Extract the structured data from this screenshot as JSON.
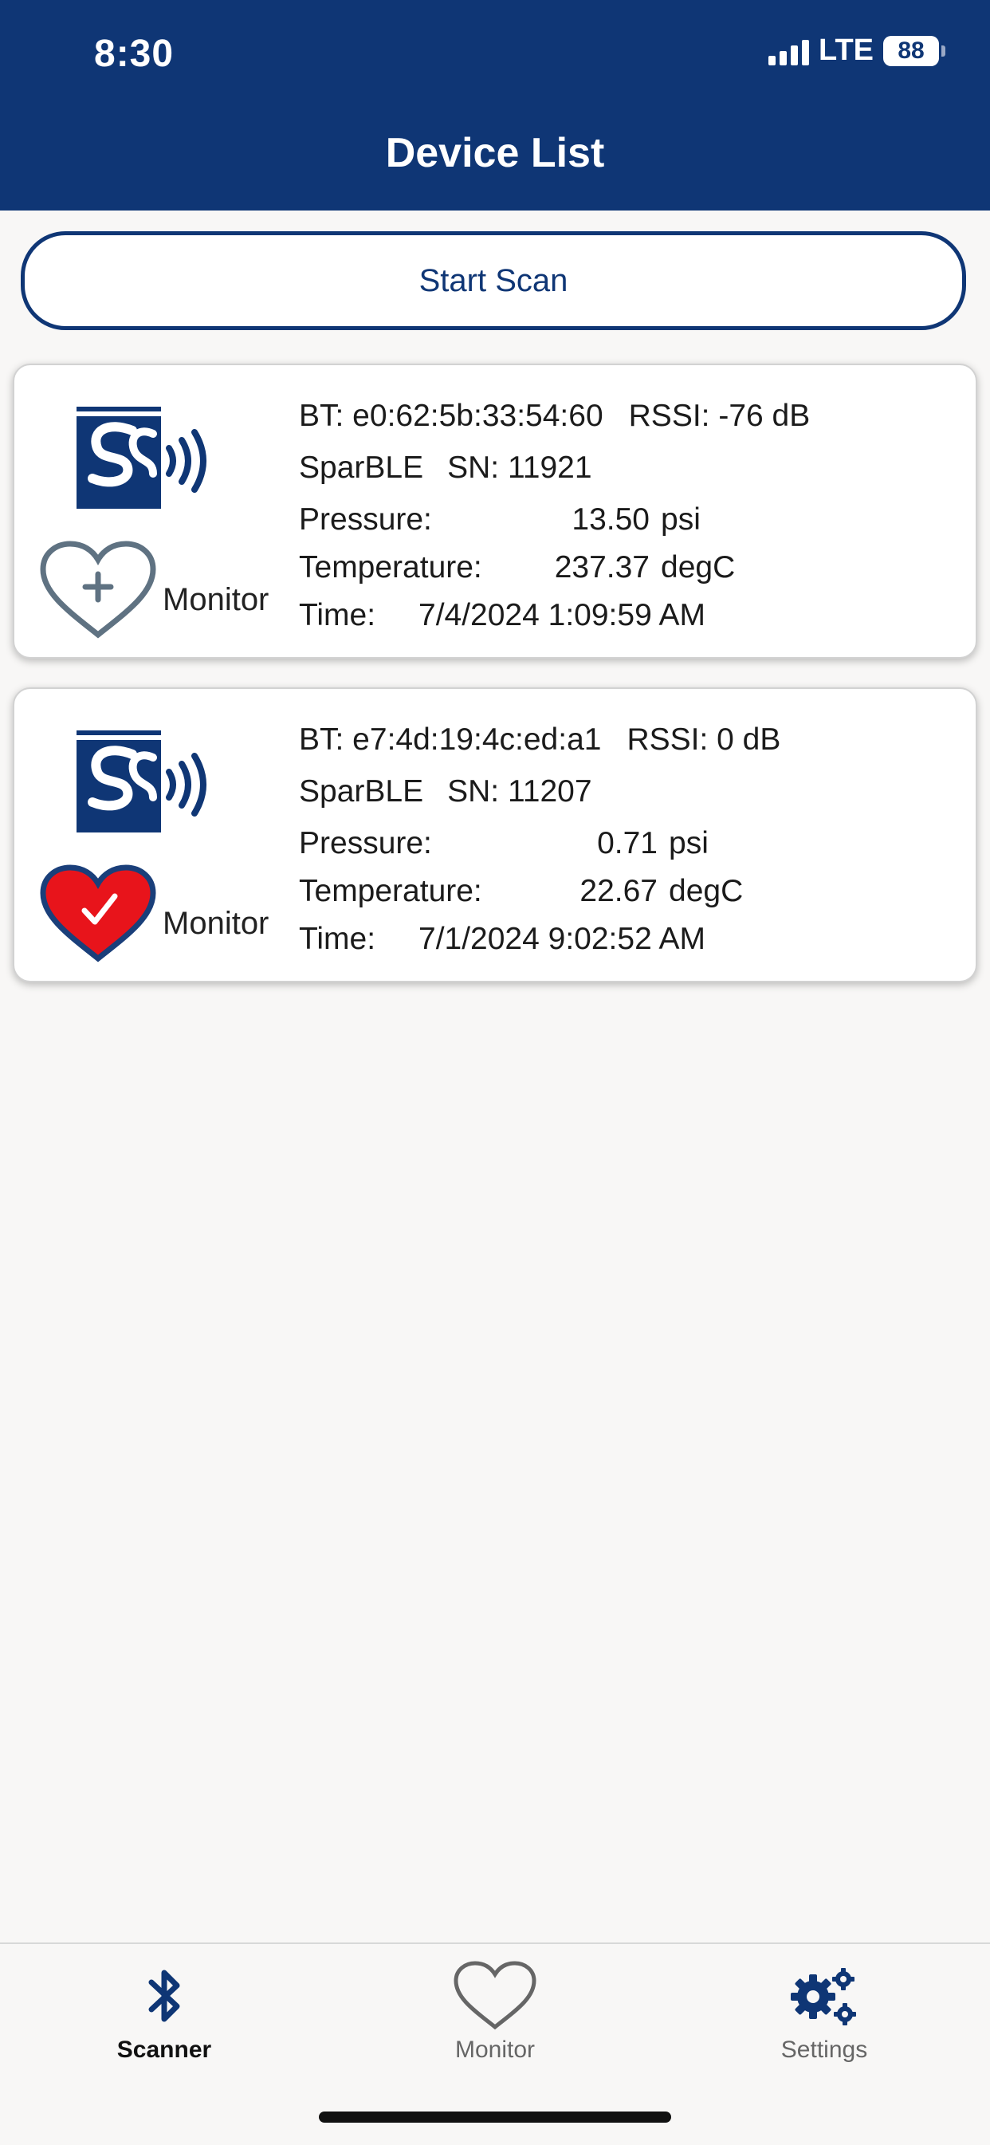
{
  "status_bar": {
    "time": "8:30",
    "network": "LTE",
    "battery": "88"
  },
  "header": {
    "title": "Device List"
  },
  "scan_button": {
    "label": "Start Scan"
  },
  "devices": [
    {
      "bt": "BT: e0:62:5b:33:54:60",
      "rssi": "RSSI: -76 dB",
      "name": "SparBLE",
      "sn": "SN: 11921",
      "pressure_label": "Pressure:",
      "pressure_value": "13.50",
      "pressure_unit": "psi",
      "temperature_label": "Temperature:",
      "temperature_value": "237.37",
      "temperature_unit": "degC",
      "time_label": "Time:",
      "time_value": "7/4/2024 1:09:59 AM",
      "monitor_label": "Monitor",
      "monitor_icon": "heart-add-icon",
      "monitored": false
    },
    {
      "bt": "BT: e7:4d:19:4c:ed:a1",
      "rssi": "RSSI: 0 dB",
      "name": "SparBLE",
      "sn": "SN: 11207",
      "pressure_label": "Pressure:",
      "pressure_value": "0.71",
      "pressure_unit": "psi",
      "temperature_label": "Temperature:",
      "temperature_value": "22.67",
      "temperature_unit": "degC",
      "time_label": "Time:",
      "time_value": "7/1/2024 9:02:52 AM",
      "monitor_label": "Monitor",
      "monitor_icon": "heart-check-icon",
      "monitored": true
    }
  ],
  "tabs": [
    {
      "label": "Scanner",
      "icon": "bluetooth-icon",
      "active": true
    },
    {
      "label": "Monitor",
      "icon": "heart-icon",
      "active": false
    },
    {
      "label": "Settings",
      "icon": "gears-icon",
      "active": false
    }
  ],
  "colors": {
    "primary": "#0f3675",
    "background": "#f8f7f6",
    "heart_active": "#e8141b",
    "heart_outline": "#5f7282",
    "tab_inactive": "#666666"
  }
}
